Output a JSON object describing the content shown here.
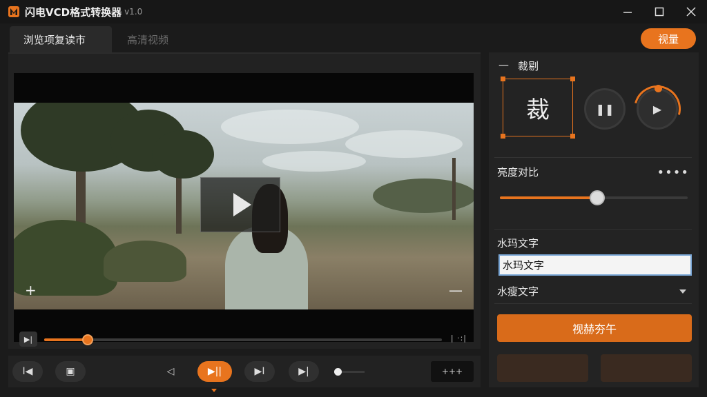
{
  "window": {
    "title": "闪电VCD格式转换器",
    "version": "v1.0",
    "minimize_icon": "minimize-icon",
    "maximize_icon": "maximize-icon",
    "close_icon": "close-icon"
  },
  "tabs": [
    {
      "label": "浏览项复读市",
      "active": true
    },
    {
      "label": "高清视频",
      "active": false
    }
  ],
  "header_button": {
    "label": "视量"
  },
  "player": {
    "progress": 0.11,
    "end_marks": "| ·:|",
    "plus_symbol": "+",
    "minus_symbol": "—",
    "play_icon": "play-icon",
    "toggle_symbol": "▶|"
  },
  "controls": {
    "prev_label": "I◀",
    "save_label": "▣",
    "rewind_label": "◁",
    "playpause_label": "▶||",
    "next_label": "▶I",
    "end_label": "▶|",
    "box_label": "+++",
    "volume": 0.1
  },
  "sidebar": {
    "crop": {
      "dash": "—",
      "title": "裁剔",
      "glyph": "裁",
      "pause_label": "❚❚",
      "play_label": "▶"
    },
    "brightness": {
      "title": "亮度对比",
      "more": "••••",
      "value": 0.52
    },
    "watermark": {
      "title": "水玛文字",
      "input_value": "水玛文字",
      "select_value": "水瘦文字"
    },
    "primary_button": {
      "label": "视赫夯午"
    }
  },
  "colors": {
    "accent": "#e8741e",
    "bg": "#1b1b1b",
    "panel": "#232323"
  }
}
